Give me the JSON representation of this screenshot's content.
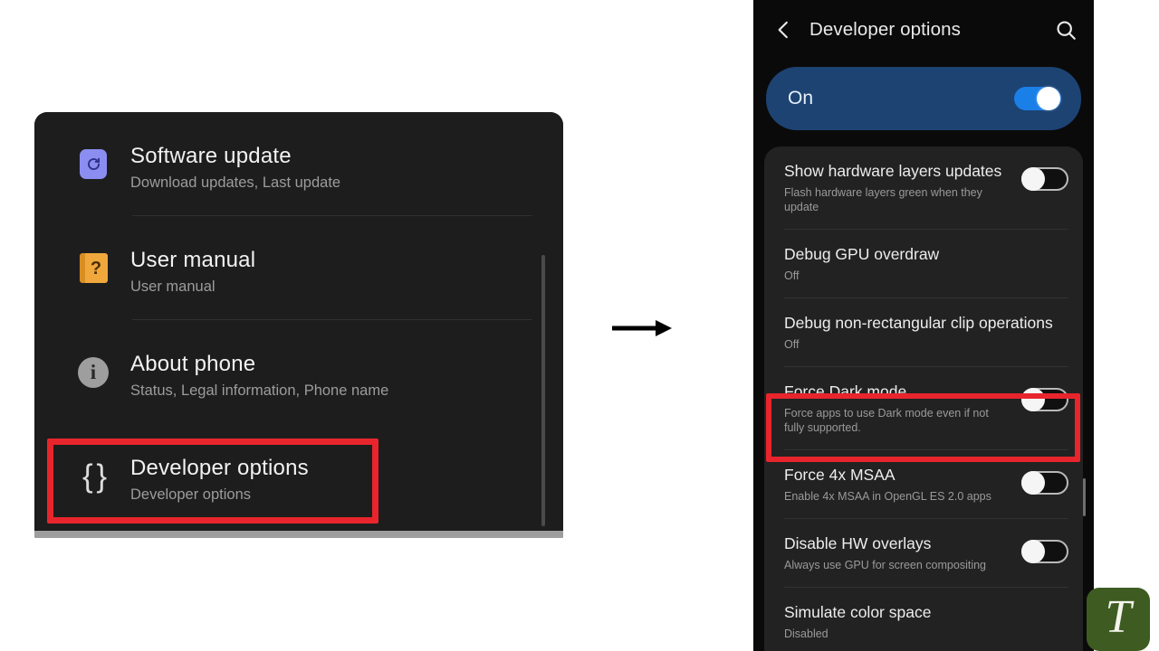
{
  "left_panel": {
    "scrollbar": "vertical-scrollbar",
    "rows": [
      {
        "icon": "software-update-icon",
        "title": "Software update",
        "subtitle": "Download updates, Last update"
      },
      {
        "icon": "user-manual-icon",
        "title": "User manual",
        "subtitle": "User manual"
      },
      {
        "icon": "about-phone-info-icon",
        "title": "About phone",
        "subtitle": "Status, Legal information, Phone name"
      },
      {
        "icon": "developer-options-braces-icon",
        "title": "Developer options",
        "subtitle": "Developer options"
      }
    ],
    "highlight": {
      "target": "Developer options",
      "color": "#e8252c"
    }
  },
  "arrow": {
    "name": "flow-arrow",
    "direction": "right",
    "color": "#000000"
  },
  "right_panel": {
    "header": {
      "back_icon": "back-chevron-icon",
      "title": "Developer options",
      "search_icon": "search-icon"
    },
    "master_switch": {
      "label": "On",
      "state": "on",
      "accent_color": "#1b7fe8",
      "card_color": "#1d4373"
    },
    "options": [
      {
        "title": "Show hardware layers updates",
        "subtitle": "Flash hardware layers green when they update",
        "control": "toggle",
        "state": "off"
      },
      {
        "title": "Debug GPU overdraw",
        "subtitle": "Off",
        "control": "none",
        "state": ""
      },
      {
        "title": "Debug non-rectangular clip operations",
        "subtitle": "Off",
        "control": "none",
        "state": ""
      },
      {
        "title": "Force Dark mode",
        "subtitle": "Force apps to use Dark mode even if not fully supported.",
        "control": "toggle",
        "state": "off"
      },
      {
        "title": "Force 4x MSAA",
        "subtitle": "Enable 4x MSAA in OpenGL ES 2.0 apps",
        "control": "toggle",
        "state": "off"
      },
      {
        "title": "Disable HW overlays",
        "subtitle": "Always use GPU for screen compositing",
        "control": "toggle",
        "state": "off"
      },
      {
        "title": "Simulate color space",
        "subtitle": "Disabled",
        "control": "none",
        "state": ""
      }
    ],
    "highlight": {
      "target": "Force Dark mode",
      "color": "#e8252c"
    },
    "scrollbar": "vertical-scrollbar"
  },
  "logo": {
    "letter": "T",
    "background_color": "#3e5c22"
  }
}
